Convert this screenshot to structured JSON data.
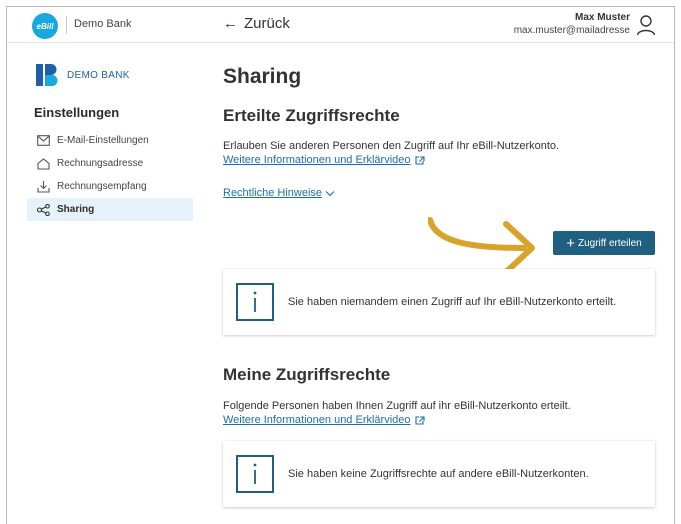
{
  "header": {
    "logo_text": "eBill",
    "bank_name": "Demo Bank",
    "back_label": "Zurück",
    "user_name": "Max Muster",
    "user_email": "max.muster@mailadresse"
  },
  "sidebar": {
    "brand": "DEMO BANK",
    "title": "Einstellungen",
    "items": [
      {
        "label": "E-Mail-Einstellungen",
        "icon": "mail-icon"
      },
      {
        "label": "Rechnungsadresse",
        "icon": "home-icon"
      },
      {
        "label": "Rechnungsempfang",
        "icon": "download-icon"
      },
      {
        "label": "Sharing",
        "icon": "share-icon",
        "active": true
      }
    ]
  },
  "main": {
    "title": "Sharing",
    "granted": {
      "title": "Erteilte Zugriffsrechte",
      "description": "Erlauben Sie anderen Personen den Zugriff auf Ihr eBill-Nutzerkonto.",
      "info_link": "Weitere Informationen und Erklärvideo",
      "legal_link": "Rechtliche Hinweise",
      "grant_button": "Zugriff erteilen",
      "empty_text": "Sie haben niemandem einen Zugriff auf Ihr eBill-Nutzerkonto erteilt."
    },
    "mine": {
      "title": "Meine Zugriffsrechte",
      "description": "Folgende Personen haben Ihnen Zugriff auf ihr eBill-Nutzerkonto erteilt.",
      "info_link": "Weitere Informationen und Erklärvideo",
      "empty_text": "Sie haben keine Zugriffsrechte auf andere eBill-Nutzerkonten."
    }
  },
  "colors": {
    "accent": "#1f5f7f",
    "link": "#1e6ea8",
    "ebill_blue": "#16a9de",
    "arrow": "#d9a32a",
    "active_bg": "#e6f2fa"
  }
}
